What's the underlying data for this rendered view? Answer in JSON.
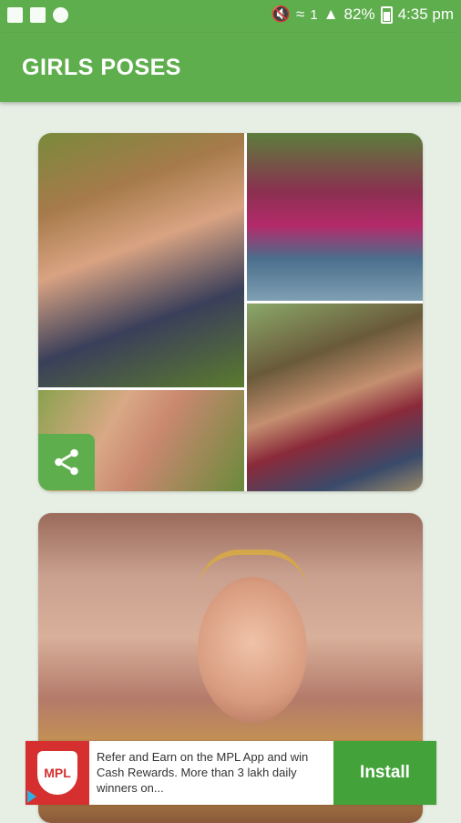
{
  "status_bar": {
    "battery": "82%",
    "time": "4:35 pm",
    "sim_slot": "1",
    "icons": [
      "image-icon",
      "folder-icon",
      "search-notification-icon",
      "mute-icon",
      "wifi-icon",
      "sim-icon",
      "signal-icon",
      "battery-icon"
    ]
  },
  "app_bar": {
    "title": "GIRLS POSES"
  },
  "ad": {
    "logo_text": "MPL",
    "text": "Refer and Earn on the MPL App and win Cash Rewards. More than 3 lakh daily winners on...",
    "install_label": "Install"
  },
  "colors": {
    "primary": "#5fae4e",
    "background": "#e7efe5",
    "install": "#43a33a",
    "ad_logo": "#d62f2f"
  }
}
